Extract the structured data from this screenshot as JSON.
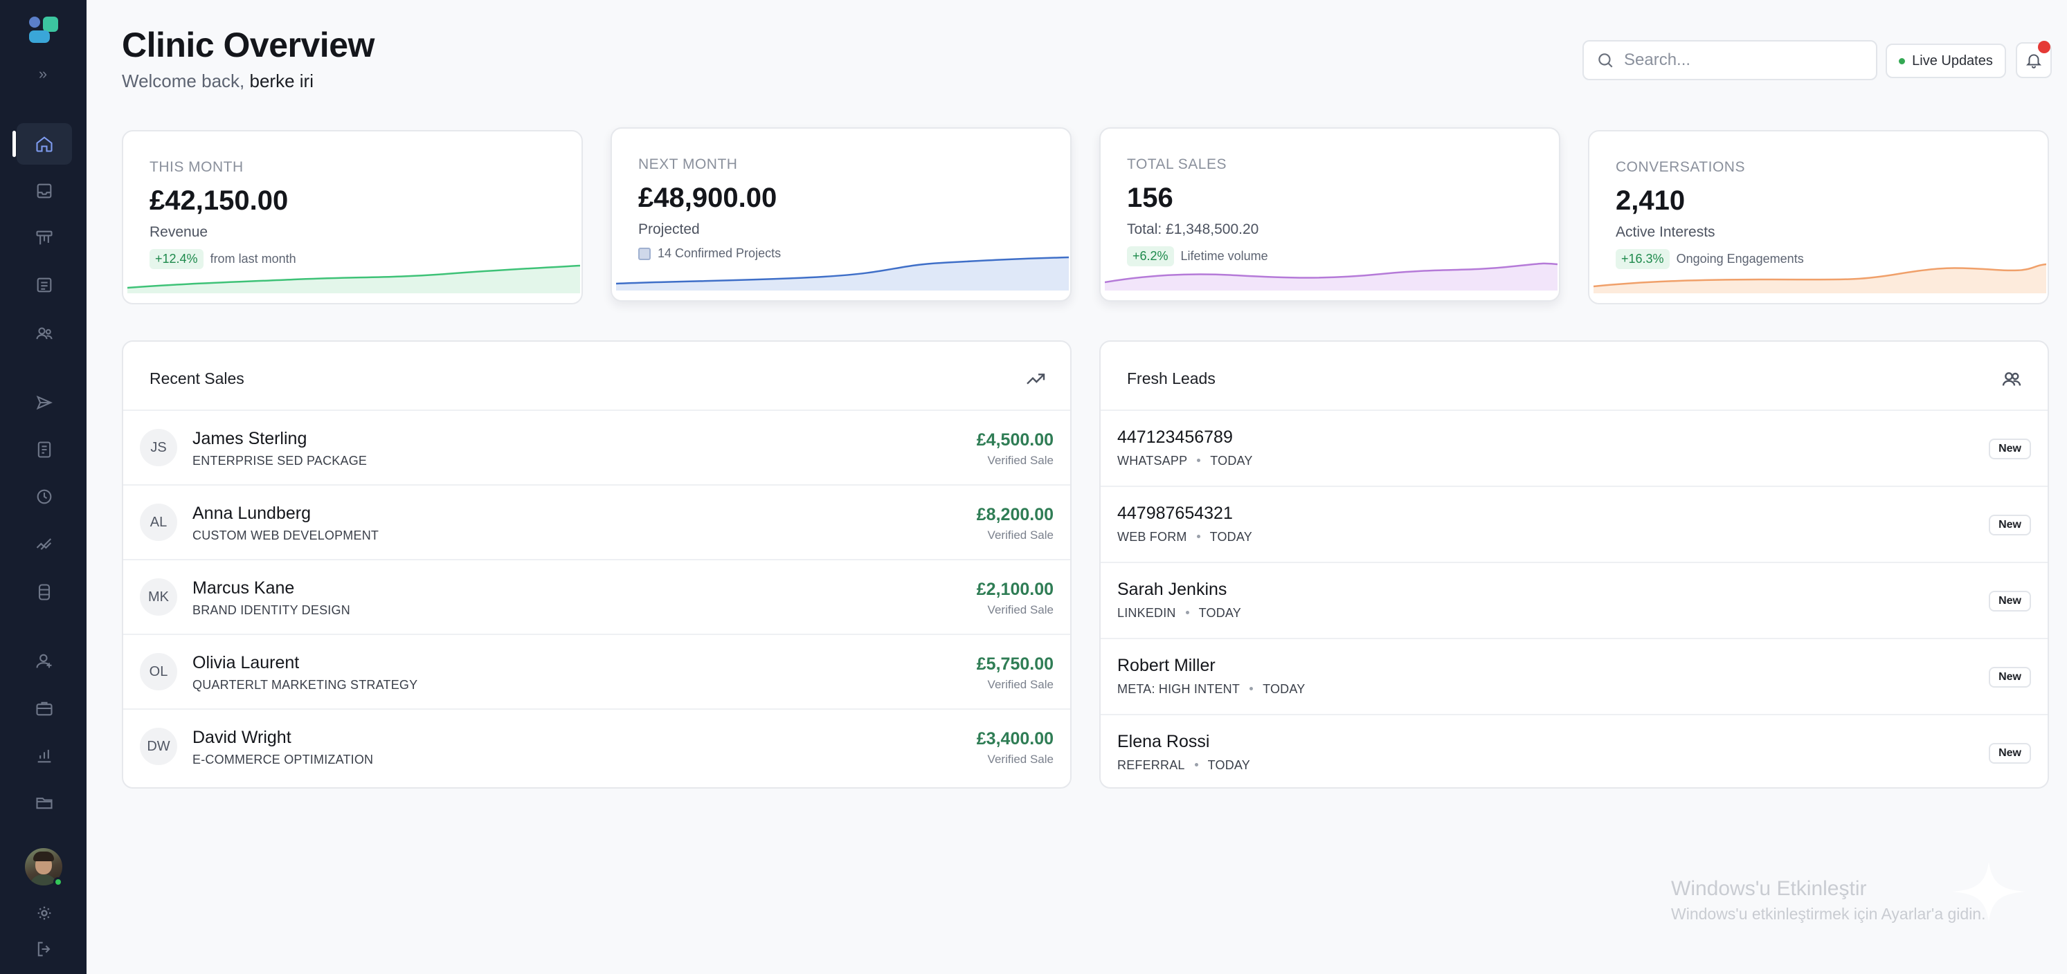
{
  "header": {
    "title": "Clinic Overview",
    "welcome_prefix": "Welcome back,",
    "user_name": "berke iri",
    "search_placeholder": "Search...",
    "live_label": "Live Updates"
  },
  "sidebar": {
    "icons": [
      "home-icon",
      "inbox-icon",
      "kanban-icon",
      "calendar-grid-icon",
      "users-icon",
      "send-icon",
      "invoice-icon",
      "clock-icon",
      "trend-check-icon",
      "database-icon",
      "user-icon",
      "briefcase-icon",
      "bar-chart-icon",
      "folder-icon"
    ],
    "active": "home-icon"
  },
  "stats": [
    {
      "label": "THIS MONTH",
      "value": "£42,150.00",
      "sub": "Revenue",
      "badge": "+12.4%",
      "meta": "from last month",
      "color": "#3ec277",
      "fill": "#e3f6ea"
    },
    {
      "label": "NEXT MONTH",
      "value": "£48,900.00",
      "sub": "Projected",
      "badge": "",
      "meta": "14 Confirmed Projects",
      "color": "#3f6fc8",
      "fill": "#dfe8f8"
    },
    {
      "label": "TOTAL SALES",
      "value": "156",
      "sub": "Total: £1,348,500.20",
      "badge": "+6.2%",
      "meta": "Lifetime volume",
      "color": "#b57ad8",
      "fill": "#f2e5fa"
    },
    {
      "label": "CONVERSATIONS",
      "value": "2,410",
      "sub": "Active Interests",
      "badge": "+16.3%",
      "meta": "Ongoing Engagements",
      "color": "#f0a06a",
      "fill": "#fdebdc"
    }
  ],
  "recent_sales": {
    "title": "Recent Sales",
    "rows": [
      {
        "initials": "JS",
        "name": "James Sterling",
        "desc": "ENTERPRISE SED PACKAGE",
        "amount": "£4,500.00",
        "status": "Verified Sale"
      },
      {
        "initials": "AL",
        "name": "Anna Lundberg",
        "desc": "CUSTOM WEB DEVELOPMENT",
        "amount": "£8,200.00",
        "status": "Verified Sale"
      },
      {
        "initials": "MK",
        "name": "Marcus Kane",
        "desc": "BRAND IDENTITY DESIGN",
        "amount": "£2,100.00",
        "status": "Verified Sale"
      },
      {
        "initials": "OL",
        "name": "Olivia Laurent",
        "desc": "QUARTERLT MARKETING STRATEGY",
        "amount": "£5,750.00",
        "status": "Verified Sale"
      },
      {
        "initials": "DW",
        "name": "David Wright",
        "desc": "E-COMMERCE OPTIMIZATION",
        "amount": "£3,400.00",
        "status": "Verified Sale"
      }
    ]
  },
  "fresh_leads": {
    "title": "Fresh Leads",
    "rows": [
      {
        "name": "447123456789",
        "source": "WHATSAPP",
        "when": "TODAY",
        "badge": "New"
      },
      {
        "name": "447987654321",
        "source": "WEB FORM",
        "when": "TODAY",
        "badge": "New"
      },
      {
        "name": "Sarah Jenkins",
        "source": "LINKEDIN",
        "when": "TODAY",
        "badge": "New"
      },
      {
        "name": "Robert Miller",
        "source": "META: HIGH INTENT",
        "when": "TODAY",
        "badge": "New"
      },
      {
        "name": "Elena Rossi",
        "source": "REFERRAL",
        "when": "TODAY",
        "badge": "New"
      }
    ]
  },
  "watermark": {
    "line1": "Windows'u Etkinleştir",
    "line2": "Windows'u etkinleştirmek için Ayarlar'a gidin."
  }
}
